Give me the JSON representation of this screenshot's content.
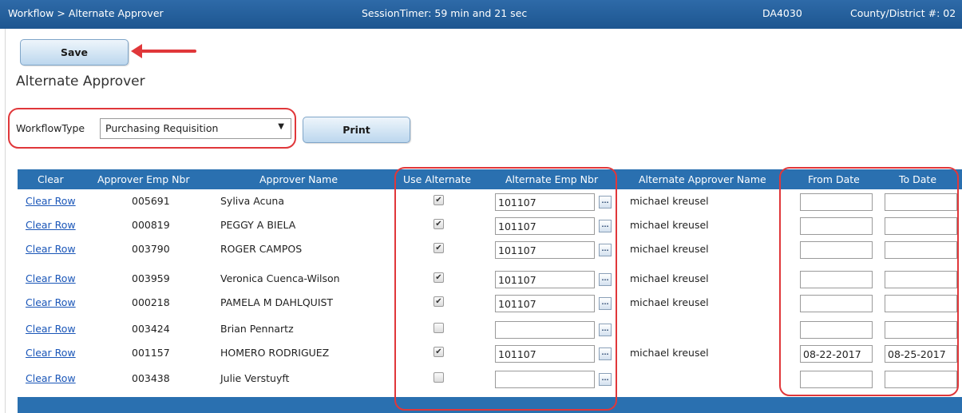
{
  "header": {
    "breadcrumb": "Workflow > Alternate Approver",
    "session_timer": "SessionTimer: 59 min and 21 sec",
    "code": "DA4030",
    "county_district": "County/District #: 02"
  },
  "toolbar": {
    "save_label": "Save",
    "print_label": "Print"
  },
  "page_title": "Alternate Approver",
  "filter": {
    "label": "WorkflowType",
    "selected": "Purchasing Requisition",
    "caret": "▼"
  },
  "table": {
    "headers": {
      "clear": "Clear",
      "approver_emp_nbr": "Approver Emp Nbr",
      "approver_name": "Approver Name",
      "use_alternate": "Use Alternate",
      "alternate_emp_nbr": "Alternate Emp Nbr",
      "alternate_approver_name": "Alternate Approver Name",
      "from_date": "From Date",
      "to_date": "To Date"
    },
    "clear_label": "Clear Row",
    "lookup_label": "...",
    "rows": [
      {
        "emp_nbr": "005691",
        "name": "Syliva Acuna",
        "use_alternate": true,
        "alt_emp": "101107",
        "alt_name": "michael kreusel",
        "from_date": "",
        "to_date": ""
      },
      {
        "emp_nbr": "000819",
        "name": "PEGGY A BIELA",
        "use_alternate": true,
        "alt_emp": "101107",
        "alt_name": "michael kreusel",
        "from_date": "",
        "to_date": ""
      },
      {
        "emp_nbr": "003790",
        "name": "ROGER CAMPOS",
        "use_alternate": true,
        "alt_emp": "101107",
        "alt_name": "michael kreusel",
        "from_date": "",
        "to_date": ""
      },
      {
        "emp_nbr": "003959",
        "name": "Veronica Cuenca-Wilson",
        "use_alternate": true,
        "alt_emp": "101107",
        "alt_name": "michael kreusel",
        "from_date": "",
        "to_date": ""
      },
      {
        "emp_nbr": "000218",
        "name": "PAMELA M DAHLQUIST",
        "use_alternate": true,
        "alt_emp": "101107",
        "alt_name": "michael kreusel",
        "from_date": "",
        "to_date": ""
      },
      {
        "emp_nbr": "003424",
        "name": "Brian Pennartz",
        "use_alternate": false,
        "alt_emp": "",
        "alt_name": "",
        "from_date": "",
        "to_date": ""
      },
      {
        "emp_nbr": "001157",
        "name": "HOMERO RODRIGUEZ",
        "use_alternate": true,
        "alt_emp": "101107",
        "alt_name": "michael kreusel",
        "from_date": "08-22-2017",
        "to_date": "08-25-2017"
      },
      {
        "emp_nbr": "003438",
        "name": "Julie Verstuyft",
        "use_alternate": false,
        "alt_emp": "",
        "alt_name": "",
        "from_date": "",
        "to_date": ""
      }
    ]
  },
  "colors": {
    "header_blue": "#2a70b0",
    "annotation_red": "#e0373a",
    "link_blue": "#1a56b8"
  }
}
